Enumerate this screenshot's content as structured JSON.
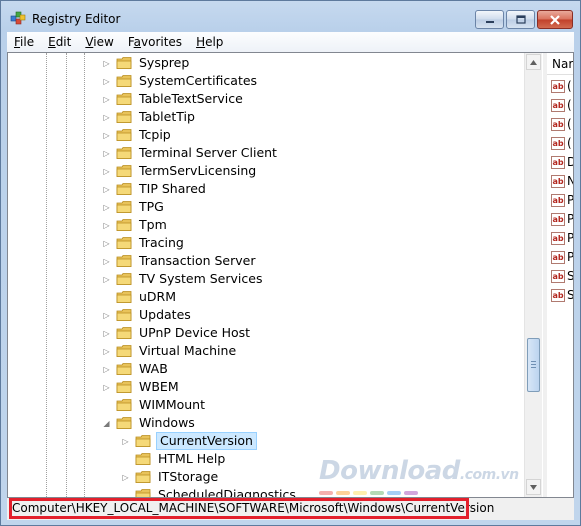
{
  "window": {
    "title": "Registry Editor",
    "controls": {
      "minimize": "–",
      "maximize": "□",
      "close": "✕"
    }
  },
  "menu": [
    {
      "underline": "F",
      "rest": "ile"
    },
    {
      "underline": "E",
      "rest": "dit"
    },
    {
      "underline": "V",
      "rest": "iew"
    },
    {
      "underline": "",
      "pre": "F",
      "mid": "a",
      "rest": "vorites"
    },
    {
      "underline": "H",
      "rest": "elp"
    }
  ],
  "tree": {
    "items": [
      {
        "label": "Sysprep",
        "level": 1,
        "expander": "▷"
      },
      {
        "label": "SystemCertificates",
        "level": 1,
        "expander": "▷"
      },
      {
        "label": "TableTextService",
        "level": 1,
        "expander": "▷"
      },
      {
        "label": "TabletTip",
        "level": 1,
        "expander": "▷"
      },
      {
        "label": "Tcpip",
        "level": 1,
        "expander": "▷"
      },
      {
        "label": "Terminal Server Client",
        "level": 1,
        "expander": "▷"
      },
      {
        "label": "TermServLicensing",
        "level": 1,
        "expander": "▷"
      },
      {
        "label": "TIP Shared",
        "level": 1,
        "expander": "▷"
      },
      {
        "label": "TPG",
        "level": 1,
        "expander": "▷"
      },
      {
        "label": "Tpm",
        "level": 1,
        "expander": "▷"
      },
      {
        "label": "Tracing",
        "level": 1,
        "expander": "▷"
      },
      {
        "label": "Transaction Server",
        "level": 1,
        "expander": "▷"
      },
      {
        "label": "TV System Services",
        "level": 1,
        "expander": "▷"
      },
      {
        "label": "uDRM",
        "level": 1,
        "expander": ""
      },
      {
        "label": "Updates",
        "level": 1,
        "expander": "▷"
      },
      {
        "label": "UPnP Device Host",
        "level": 1,
        "expander": "▷"
      },
      {
        "label": "Virtual Machine",
        "level": 1,
        "expander": "▷"
      },
      {
        "label": "WAB",
        "level": 1,
        "expander": "▷"
      },
      {
        "label": "WBEM",
        "level": 1,
        "expander": "▷"
      },
      {
        "label": "WIMMount",
        "level": 1,
        "expander": ""
      },
      {
        "label": "Windows",
        "level": 1,
        "expander": "◢"
      },
      {
        "label": "CurrentVersion",
        "level": 2,
        "expander": "▷",
        "selected": true
      },
      {
        "label": "HTML Help",
        "level": 2,
        "expander": ""
      },
      {
        "label": "ITStorage",
        "level": 2,
        "expander": "▷"
      },
      {
        "label": "ScheduledDiagnostics",
        "level": 2,
        "expander": ""
      }
    ]
  },
  "values_pane": {
    "header": "Nar",
    "rows": [
      "(",
      "(",
      "(",
      "(",
      "D",
      "N",
      "P",
      "P",
      "P",
      "P",
      "S",
      "S"
    ],
    "icon_text": "ab"
  },
  "status": {
    "path": "Computer\\HKEY_LOCAL_MACHINE\\SOFTWARE\\Microsoft\\Windows\\CurrentVersion"
  },
  "watermark": {
    "main": "Download",
    "suffix": ".com.vn"
  },
  "colors": {
    "highlight_border": "#e3202c",
    "selection_fill": "#cce8ff",
    "folder": "#e8c35a"
  }
}
